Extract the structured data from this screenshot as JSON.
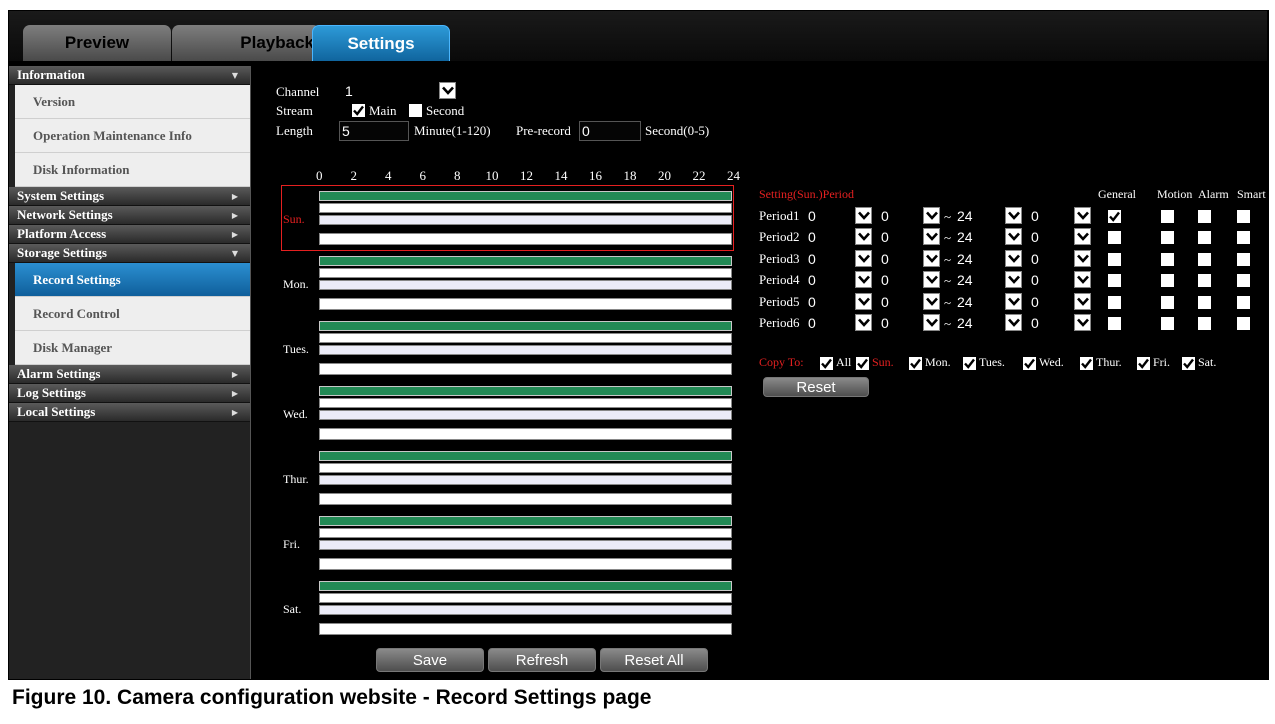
{
  "tabs": [
    {
      "label": "Preview",
      "active": false
    },
    {
      "label": "Playback",
      "active": false
    },
    {
      "label": "Settings",
      "active": true
    }
  ],
  "sidebar": {
    "sections": [
      {
        "label": "Information",
        "expanded": true,
        "items": [
          {
            "label": "Version",
            "active": false
          },
          {
            "label": "Operation Maintenance Info",
            "active": false
          },
          {
            "label": "Disk Information",
            "active": false
          }
        ]
      },
      {
        "label": "System Settings",
        "expanded": false,
        "items": []
      },
      {
        "label": "Network Settings",
        "expanded": false,
        "items": []
      },
      {
        "label": "Platform Access",
        "expanded": false,
        "items": []
      },
      {
        "label": "Storage Settings",
        "expanded": true,
        "items": [
          {
            "label": "Record Settings",
            "active": true
          },
          {
            "label": "Record Control",
            "active": false
          },
          {
            "label": "Disk Manager",
            "active": false
          }
        ]
      },
      {
        "label": "Alarm Settings",
        "expanded": false,
        "items": []
      },
      {
        "label": "Log Settings",
        "expanded": false,
        "items": []
      },
      {
        "label": "Local Settings",
        "expanded": false,
        "items": []
      }
    ]
  },
  "form": {
    "channel_label": "Channel",
    "channel_value": "1",
    "stream_label": "Stream",
    "stream_main": "Main",
    "stream_main_checked": true,
    "stream_second": "Second",
    "stream_second_checked": false,
    "length_label": "Length",
    "length_value": "5",
    "length_unit": "Minute(1-120)",
    "prerecord_label": "Pre-record",
    "prerecord_value": "0",
    "prerecord_unit": "Second(0-5)"
  },
  "schedule": {
    "hours": [
      "0",
      "2",
      "4",
      "6",
      "8",
      "10",
      "12",
      "14",
      "16",
      "18",
      "20",
      "22",
      "24"
    ],
    "days": [
      {
        "label": "Sun.",
        "selected": true
      },
      {
        "label": "Mon.",
        "selected": false
      },
      {
        "label": "Tues.",
        "selected": false
      },
      {
        "label": "Wed.",
        "selected": false
      },
      {
        "label": "Thur.",
        "selected": false
      },
      {
        "label": "Fri.",
        "selected": false
      },
      {
        "label": "Sat.",
        "selected": false
      }
    ]
  },
  "periods": {
    "header_label": "Setting(Sun.)Period",
    "columns": [
      "General",
      "Motion",
      "Alarm",
      "Smart"
    ],
    "rows": [
      {
        "label": "Period1",
        "start_hour": "0",
        "start_min": "0",
        "end_hour": "24",
        "end_min": "0",
        "general": true,
        "motion": false,
        "alarm": false,
        "smart": false
      },
      {
        "label": "Period2",
        "start_hour": "0",
        "start_min": "0",
        "end_hour": "24",
        "end_min": "0",
        "general": false,
        "motion": false,
        "alarm": false,
        "smart": false
      },
      {
        "label": "Period3",
        "start_hour": "0",
        "start_min": "0",
        "end_hour": "24",
        "end_min": "0",
        "general": false,
        "motion": false,
        "alarm": false,
        "smart": false
      },
      {
        "label": "Period4",
        "start_hour": "0",
        "start_min": "0",
        "end_hour": "24",
        "end_min": "0",
        "general": false,
        "motion": false,
        "alarm": false,
        "smart": false
      },
      {
        "label": "Period5",
        "start_hour": "0",
        "start_min": "0",
        "end_hour": "24",
        "end_min": "0",
        "general": false,
        "motion": false,
        "alarm": false,
        "smart": false
      },
      {
        "label": "Period6",
        "start_hour": "0",
        "start_min": "0",
        "end_hour": "24",
        "end_min": "0",
        "general": false,
        "motion": false,
        "alarm": false,
        "smart": false
      }
    ],
    "separator": "~",
    "copy_to_label": "Copy To:",
    "copy_to": [
      {
        "label": "All",
        "checked": true,
        "red": false
      },
      {
        "label": "Sun.",
        "checked": true,
        "red": true
      },
      {
        "label": "Mon.",
        "checked": true,
        "red": false
      },
      {
        "label": "Tues.",
        "checked": true,
        "red": false
      },
      {
        "label": "Wed.",
        "checked": true,
        "red": false
      },
      {
        "label": "Thur.",
        "checked": true,
        "red": false
      },
      {
        "label": "Fri.",
        "checked": true,
        "red": false
      },
      {
        "label": "Sat.",
        "checked": true,
        "red": false
      }
    ],
    "reset_label": "Reset"
  },
  "buttons": {
    "save": "Save",
    "refresh": "Refresh",
    "reset_all": "Reset All"
  },
  "caption": "Figure 10.  Camera configuration website - Record Settings page",
  "colors": {
    "accent": "#1a80c4",
    "schedule_green": "#228a55",
    "highlight_red": "#e52020"
  }
}
